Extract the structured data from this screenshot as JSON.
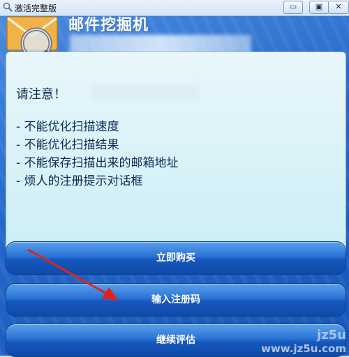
{
  "window": {
    "title": "激活完整版",
    "minimize_label": "▭",
    "maximize_label": "▣",
    "close_label": "✕"
  },
  "app": {
    "name": "邮件挖掘机"
  },
  "notice": {
    "title": "请注意！",
    "features": [
      "- 不能优化扫描速度",
      "- 不能优化扫描结果",
      "- 不能保存扫描出来的邮箱地址",
      "- 烦人的注册提示对话框"
    ]
  },
  "buttons": {
    "buy": "立即购买",
    "register": "输入注册码",
    "continue": "继续评估"
  },
  "watermark": {
    "line1": "jz5u",
    "line2": "www.jz5u.com"
  },
  "colors": {
    "accent": "#1558bd",
    "panel": "#d8f1f8",
    "arrow": "#e0221b"
  }
}
